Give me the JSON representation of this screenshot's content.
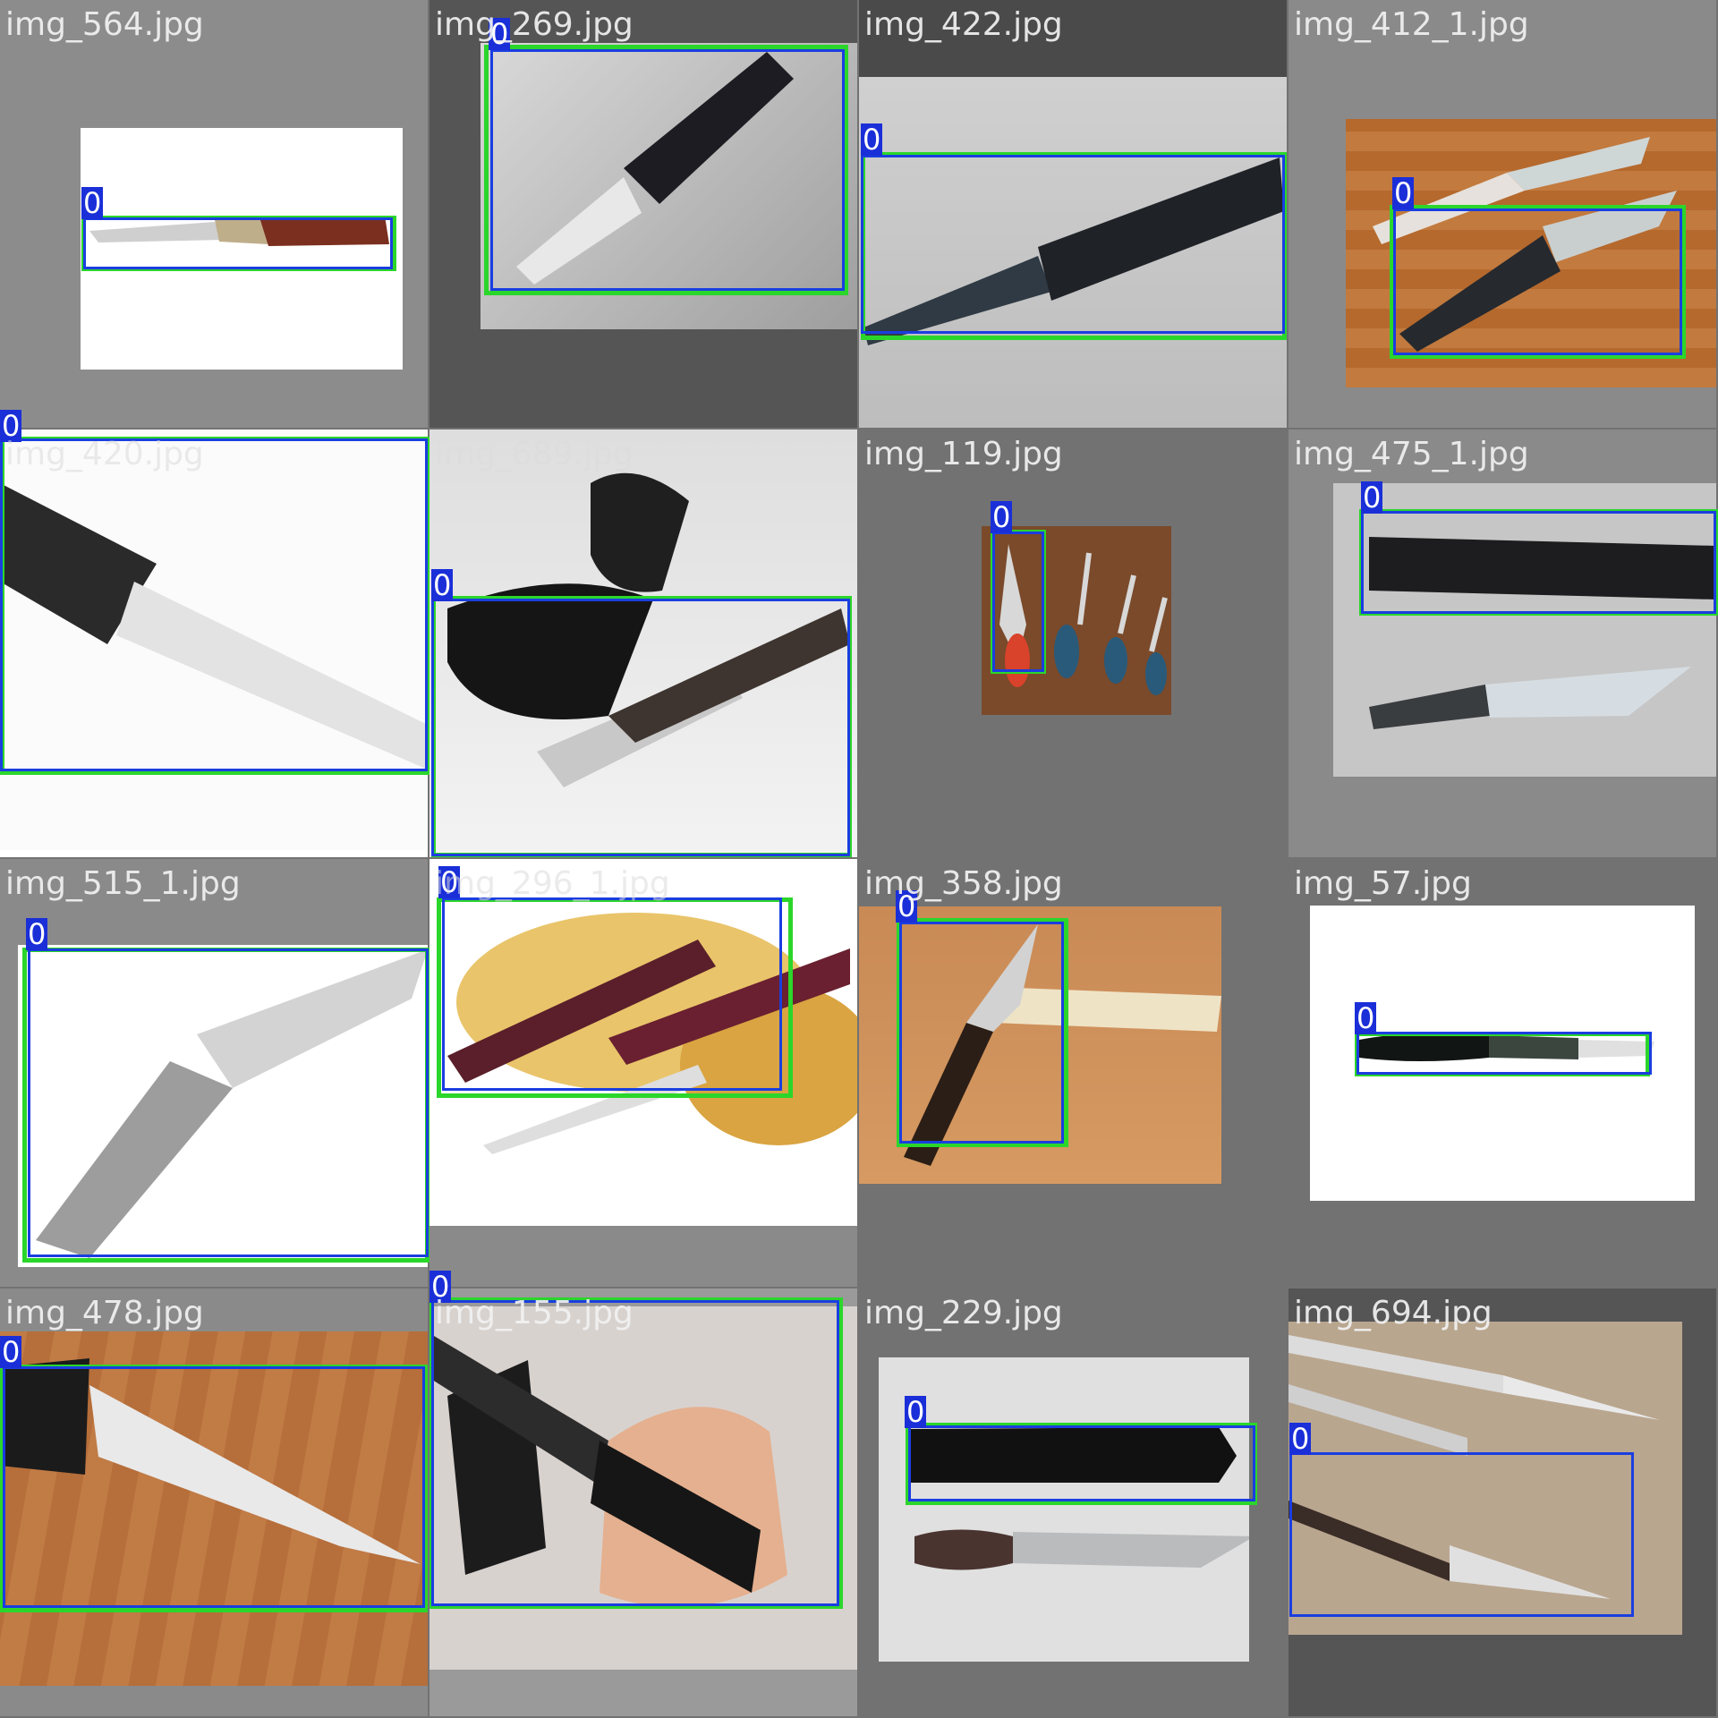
{
  "mosaic": {
    "tiles": [
      {
        "filename": "img_564.jpg",
        "subject": "folding knife with wooden handle"
      },
      {
        "filename": "img_269.jpg",
        "subject": "fixed blade knife with black handle"
      },
      {
        "filename": "img_422.jpg",
        "subject": "black fixed blade knife"
      },
      {
        "filename": "img_412_1.jpg",
        "subject": "two folding knives on wooden table"
      },
      {
        "filename": "img_420.jpg",
        "subject": "close-up of knife blade"
      },
      {
        "filename": "img_689.jpg",
        "subject": "folding knife with leather sheath"
      },
      {
        "filename": "img_119.jpg",
        "subject": "four pairs of scissors on wood"
      },
      {
        "filename": "img_475_1.jpg",
        "subject": "fixed knife with leather sheath"
      },
      {
        "filename": "img_515_1.jpg",
        "subject": "grey folding knife"
      },
      {
        "filename": "img_296_1.jpg",
        "subject": "folding knives on wooden slices"
      },
      {
        "filename": "img_358.jpg",
        "subject": "folding knife on wooden board"
      },
      {
        "filename": "img_57.jpg",
        "subject": "folding knife on white background"
      },
      {
        "filename": "img_478.jpg",
        "subject": "serrated knife on wooden floor"
      },
      {
        "filename": "img_155.jpg",
        "subject": "black knife held in hand"
      },
      {
        "filename": "img_229.jpg",
        "subject": "hunting knife and sheath"
      },
      {
        "filename": "img_694.jpg",
        "subject": "butterfly knives"
      }
    ],
    "class_label": "0",
    "colors": {
      "ground_truth_box": "#2bd62b",
      "prediction_box": "#1a3ee0",
      "label_bg": "#1a2fd8"
    }
  }
}
